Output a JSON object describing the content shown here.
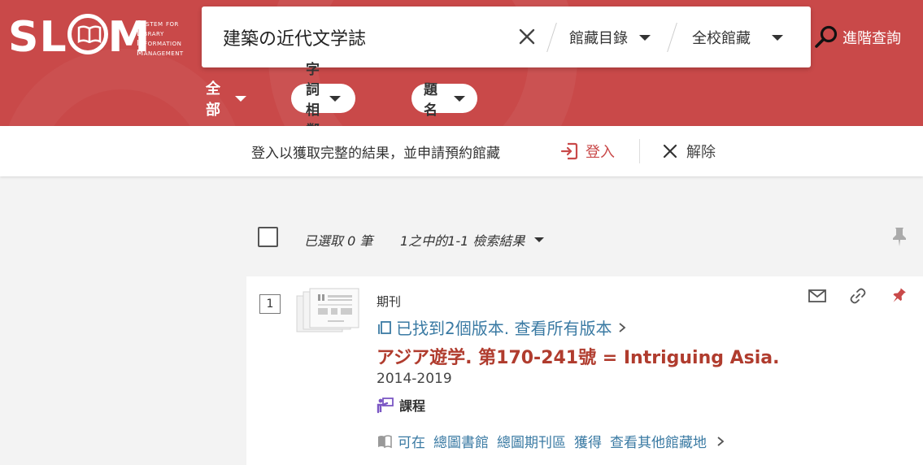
{
  "header": {
    "logo": {
      "word": "SLIM",
      "tagline": [
        "System for",
        "Library",
        "Information",
        "Management"
      ]
    },
    "search": {
      "query": "建築の近代文学誌",
      "scope_label": "館藏目錄",
      "collection_label": "全校館藏"
    },
    "advanced_label": "進階查詢",
    "filters": {
      "all_label": "全部",
      "match_label": "字詞相鄰",
      "field_label": "題名"
    },
    "colors": {
      "brand": "#c94949"
    }
  },
  "login_bar": {
    "message": "登入以獲取完整的結果，並申請預約館藏",
    "login_label": "登入",
    "dismiss_label": "解除"
  },
  "results_header": {
    "selected": "已選取 0 筆",
    "count": "1之中的1-1 檢索結果"
  },
  "results": [
    {
      "index": "1",
      "type": "期刊",
      "versions": "已找到2個版本. 查看所有版本",
      "title": "アジア遊学. 第170-241號 = Intriguing Asia.",
      "date": "2014-2019",
      "course": "課程",
      "availability": {
        "prefix": "可在",
        "library": "總圖書館",
        "location": "總圖期刊區",
        "status": "獲得",
        "more": "查看其他館藏地"
      }
    }
  ]
}
